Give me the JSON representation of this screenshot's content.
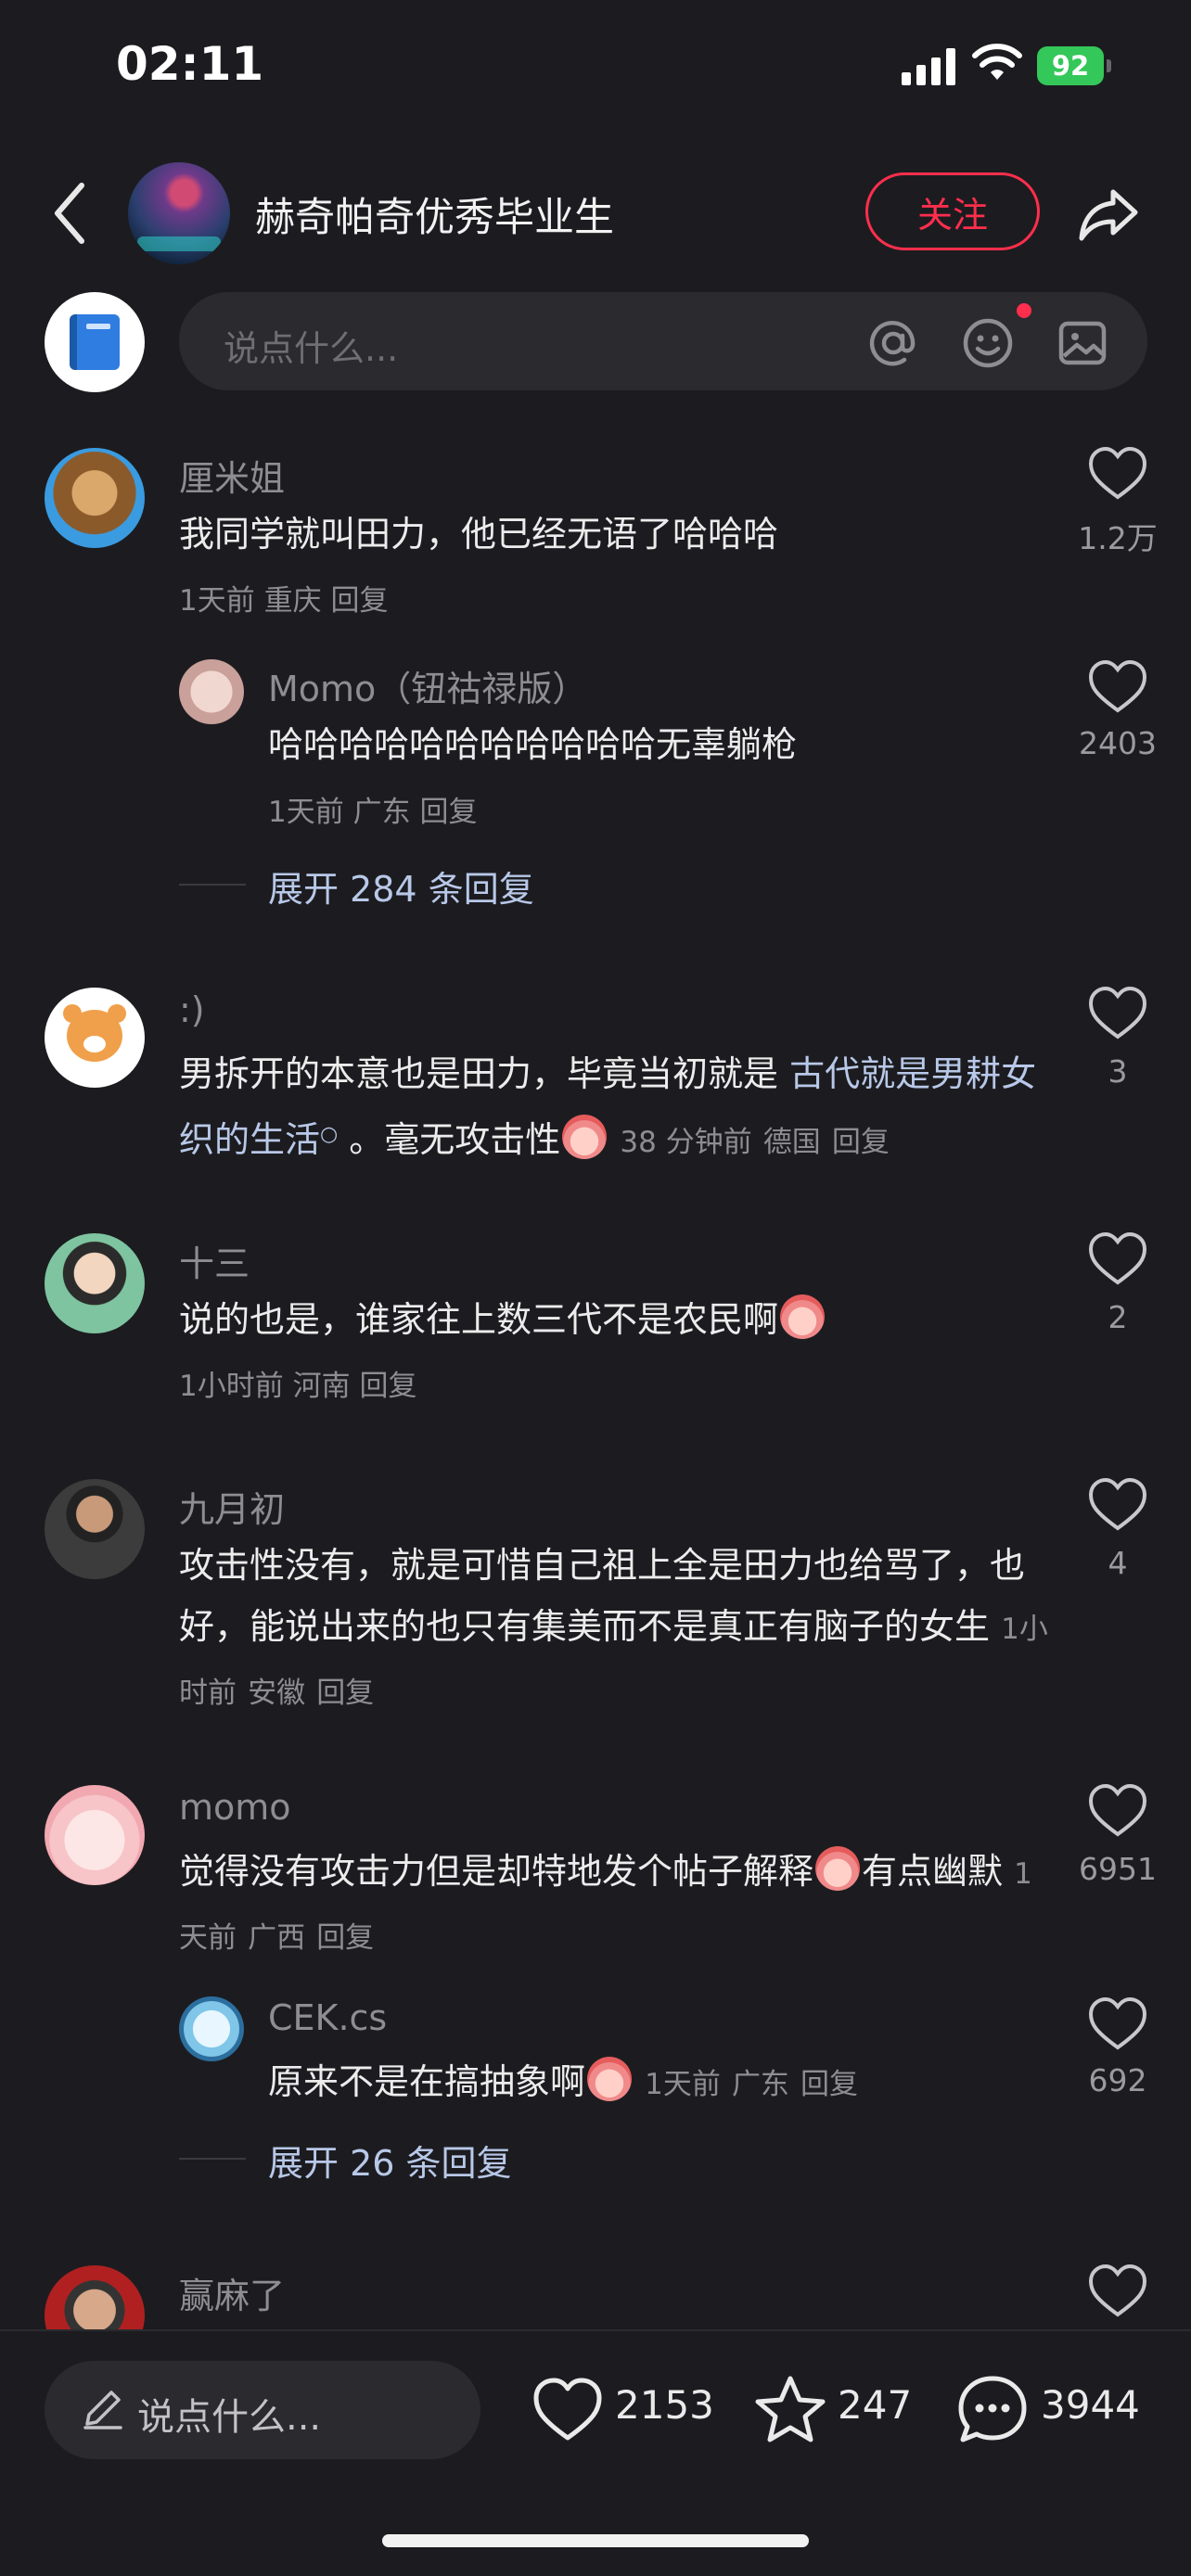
{
  "status_bar": {
    "time": "02:11",
    "battery": "92"
  },
  "header": {
    "author_name": "赫奇帕奇优秀毕业生",
    "follow_label": "关注"
  },
  "comment_input": {
    "placeholder": "说点什么..."
  },
  "comments": [
    {
      "username": "厘米姐",
      "text": "我同学就叫田力，他已经无语了哈哈哈",
      "time": "1天前",
      "location": "重庆",
      "reply": "回复",
      "likes": "1.2万",
      "replies": [
        {
          "username": "Momo（钮祜禄版）",
          "text": "哈哈哈哈哈哈哈哈哈哈哈无辜躺枪",
          "time": "1天前",
          "location": "广东",
          "reply": "回复",
          "likes": "2403"
        }
      ],
      "expand": "展开 284 条回复"
    },
    {
      "username": ":)",
      "text_line1_a": "男拆开的本意也是田力，毕竟当初就是 ",
      "text_link": "古代就是男耕女织的生活",
      "text_after_link": " 。毫无攻击性",
      "time": "38 分钟前",
      "location": "德国",
      "reply": "回复",
      "likes": "3"
    },
    {
      "username": "十三",
      "text": "说的也是，谁家往上数三代不是农民啊",
      "time": "1小时前",
      "location": "河南",
      "reply": "回复",
      "likes": "2"
    },
    {
      "username": "九月初",
      "text": "攻击性没有，就是可惜自己祖上全是田力也给骂了，也好，能说出来的也只有集美而不是真正有脑子的女生",
      "time": "1小时前",
      "location": "安徽",
      "reply": "回复",
      "likes": "4"
    },
    {
      "username": "momo",
      "text_a": "觉得没有攻击力但是却特地发个帖子解释",
      "text_b": "有点幽默",
      "time": "1天前",
      "location": "广西",
      "reply": "回复",
      "likes": "6951",
      "replies": [
        {
          "username": "CEK.cs",
          "text": "原来不是在搞抽象啊",
          "time": "1天前",
          "location": "广东",
          "reply": "回复",
          "likes": "692"
        }
      ],
      "expand": "展开 26 条回复"
    },
    {
      "username": "赢麻了"
    }
  ],
  "bottom_bar": {
    "placeholder": "说点什么...",
    "likes": "2153",
    "stars": "247",
    "comments": "3944"
  },
  "colors": {
    "background": "#1c1c20",
    "accent": "#ff2e4d",
    "link": "#b8c8e8",
    "muted": "#8d8d92"
  },
  "icons": [
    "back-icon",
    "share-icon",
    "at-icon",
    "emoji-icon",
    "image-icon",
    "heart-icon",
    "star-icon",
    "comment-icon",
    "pencil-icon"
  ]
}
